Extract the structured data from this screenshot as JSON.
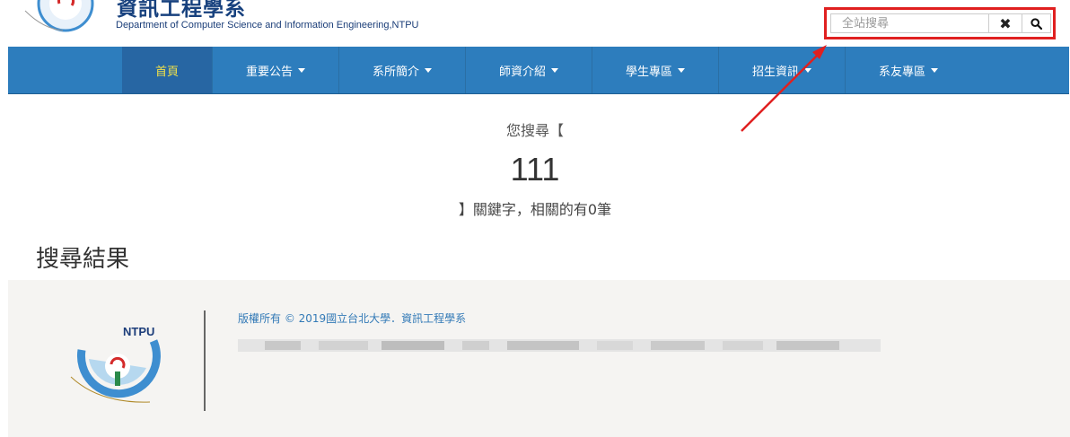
{
  "header": {
    "title": "資訊工程學系",
    "subtitle": "Department of Computer Science and Information Engineering,NTPU"
  },
  "search": {
    "placeholder": "全站搜尋",
    "clear_icon": "✖"
  },
  "nav": {
    "items": [
      {
        "label": "首頁",
        "dropdown": false,
        "active": true
      },
      {
        "label": "重要公告",
        "dropdown": true
      },
      {
        "label": "系所簡介",
        "dropdown": true
      },
      {
        "label": "師資介紹",
        "dropdown": true
      },
      {
        "label": "學生專區",
        "dropdown": true
      },
      {
        "label": "招生資訊",
        "dropdown": true
      },
      {
        "label": "系友專區",
        "dropdown": true
      }
    ]
  },
  "main": {
    "searched_prefix": "您搜尋【",
    "keyword": "111",
    "result_suffix": "】關鍵字，相關的有0筆",
    "results_heading": "搜尋結果"
  },
  "footer": {
    "copyright": "版權所有 © 2019國立台北大學．資訊工程學系",
    "logo_text": "NTPU"
  },
  "colors": {
    "nav_bg": "#2d7dbd",
    "nav_active_text": "#f0e04a",
    "highlight_red": "#e02020",
    "title_blue": "#17417e"
  }
}
